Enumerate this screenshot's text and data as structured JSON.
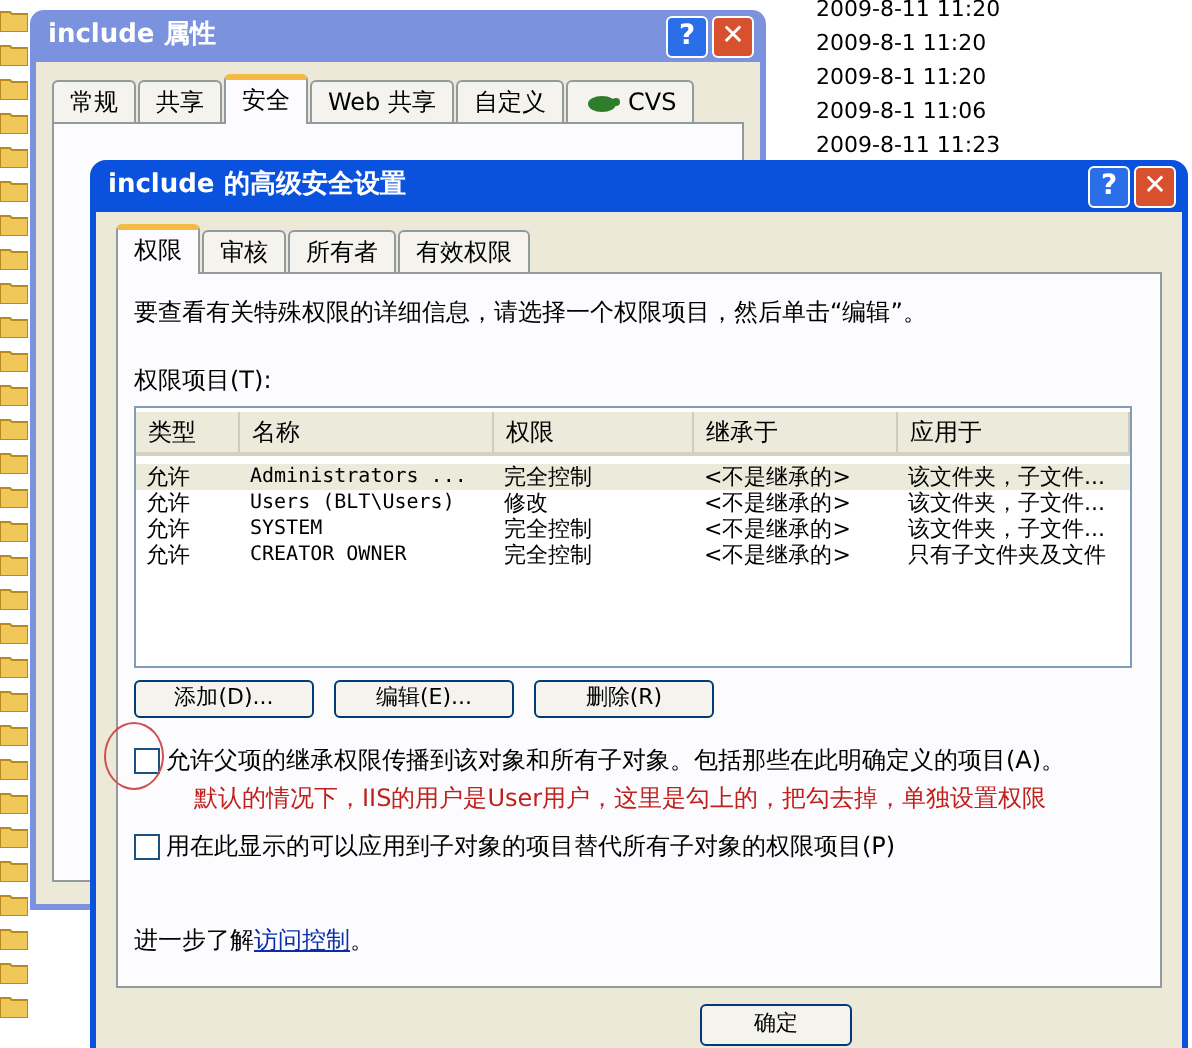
{
  "explorer": {
    "dates": [
      "2009-8-11 11:20",
      "2009-8-1 11:20",
      "2009-8-1 11:20",
      "2009-8-1 11:06",
      "2009-8-11 11:23"
    ]
  },
  "properties_dialog": {
    "title": "include 属性",
    "tabs": [
      {
        "label": "常规",
        "selected": false
      },
      {
        "label": "共享",
        "selected": false
      },
      {
        "label": "安全",
        "selected": true
      },
      {
        "label": "Web 共享",
        "selected": false
      },
      {
        "label": "自定义",
        "selected": false
      },
      {
        "label": "CVS",
        "selected": false,
        "kind": "icon"
      }
    ],
    "title_buttons": [
      "?",
      "✕"
    ]
  },
  "advanced_dialog": {
    "title": "include 的高级安全设置",
    "title_buttons": [
      "?",
      "✕"
    ],
    "tabs": [
      {
        "label": "权限",
        "selected": true
      },
      {
        "label": "审核",
        "selected": false
      },
      {
        "label": "所有者",
        "selected": false
      },
      {
        "label": "有效权限",
        "selected": false
      }
    ],
    "intro": "要查看有关特殊权限的详细信息，请选择一个权限项目，然后单击“编辑”。",
    "list_label": "权限项目(T):",
    "table": {
      "columns": [
        "类型",
        "名称",
        "权限",
        "继承于",
        "应用于"
      ],
      "rows": [
        {
          "cells": [
            "允许",
            "Administrators ...",
            "完全控制",
            "<不是继承的>",
            "该文件夹，子文件..."
          ],
          "selected": true
        },
        {
          "cells": [
            "允许",
            "Users (BLT\\Users)",
            "修改",
            "<不是继承的>",
            "该文件夹，子文件..."
          ],
          "selected": false
        },
        {
          "cells": [
            "允许",
            "SYSTEM",
            "完全控制",
            "<不是继承的>",
            "该文件夹，子文件..."
          ],
          "selected": false
        },
        {
          "cells": [
            "允许",
            "CREATOR OWNER",
            "完全控制",
            "<不是继承的>",
            "只有子文件夹及文件"
          ],
          "selected": false
        }
      ]
    },
    "buttons": [
      "添加(D)...",
      "编辑(E)...",
      "删除(R)"
    ],
    "checkboxes": [
      {
        "label": "允许父项的继承权限传播到该对象和所有子对象。包括那些在此明确定义的项目(A)。",
        "checked": false
      },
      {
        "label": "用在此显示的可以应用到子对象的项目替代所有子对象的权限项目(P)",
        "checked": false
      }
    ],
    "annotation": "默认的情况下，IIS的用户是User用户，这里是勾上的，把勾去掉，单独设置权限",
    "learn_more": {
      "text": "进一步了解",
      "link": "访问控制",
      "end": "。"
    },
    "ok_button": "确定"
  }
}
